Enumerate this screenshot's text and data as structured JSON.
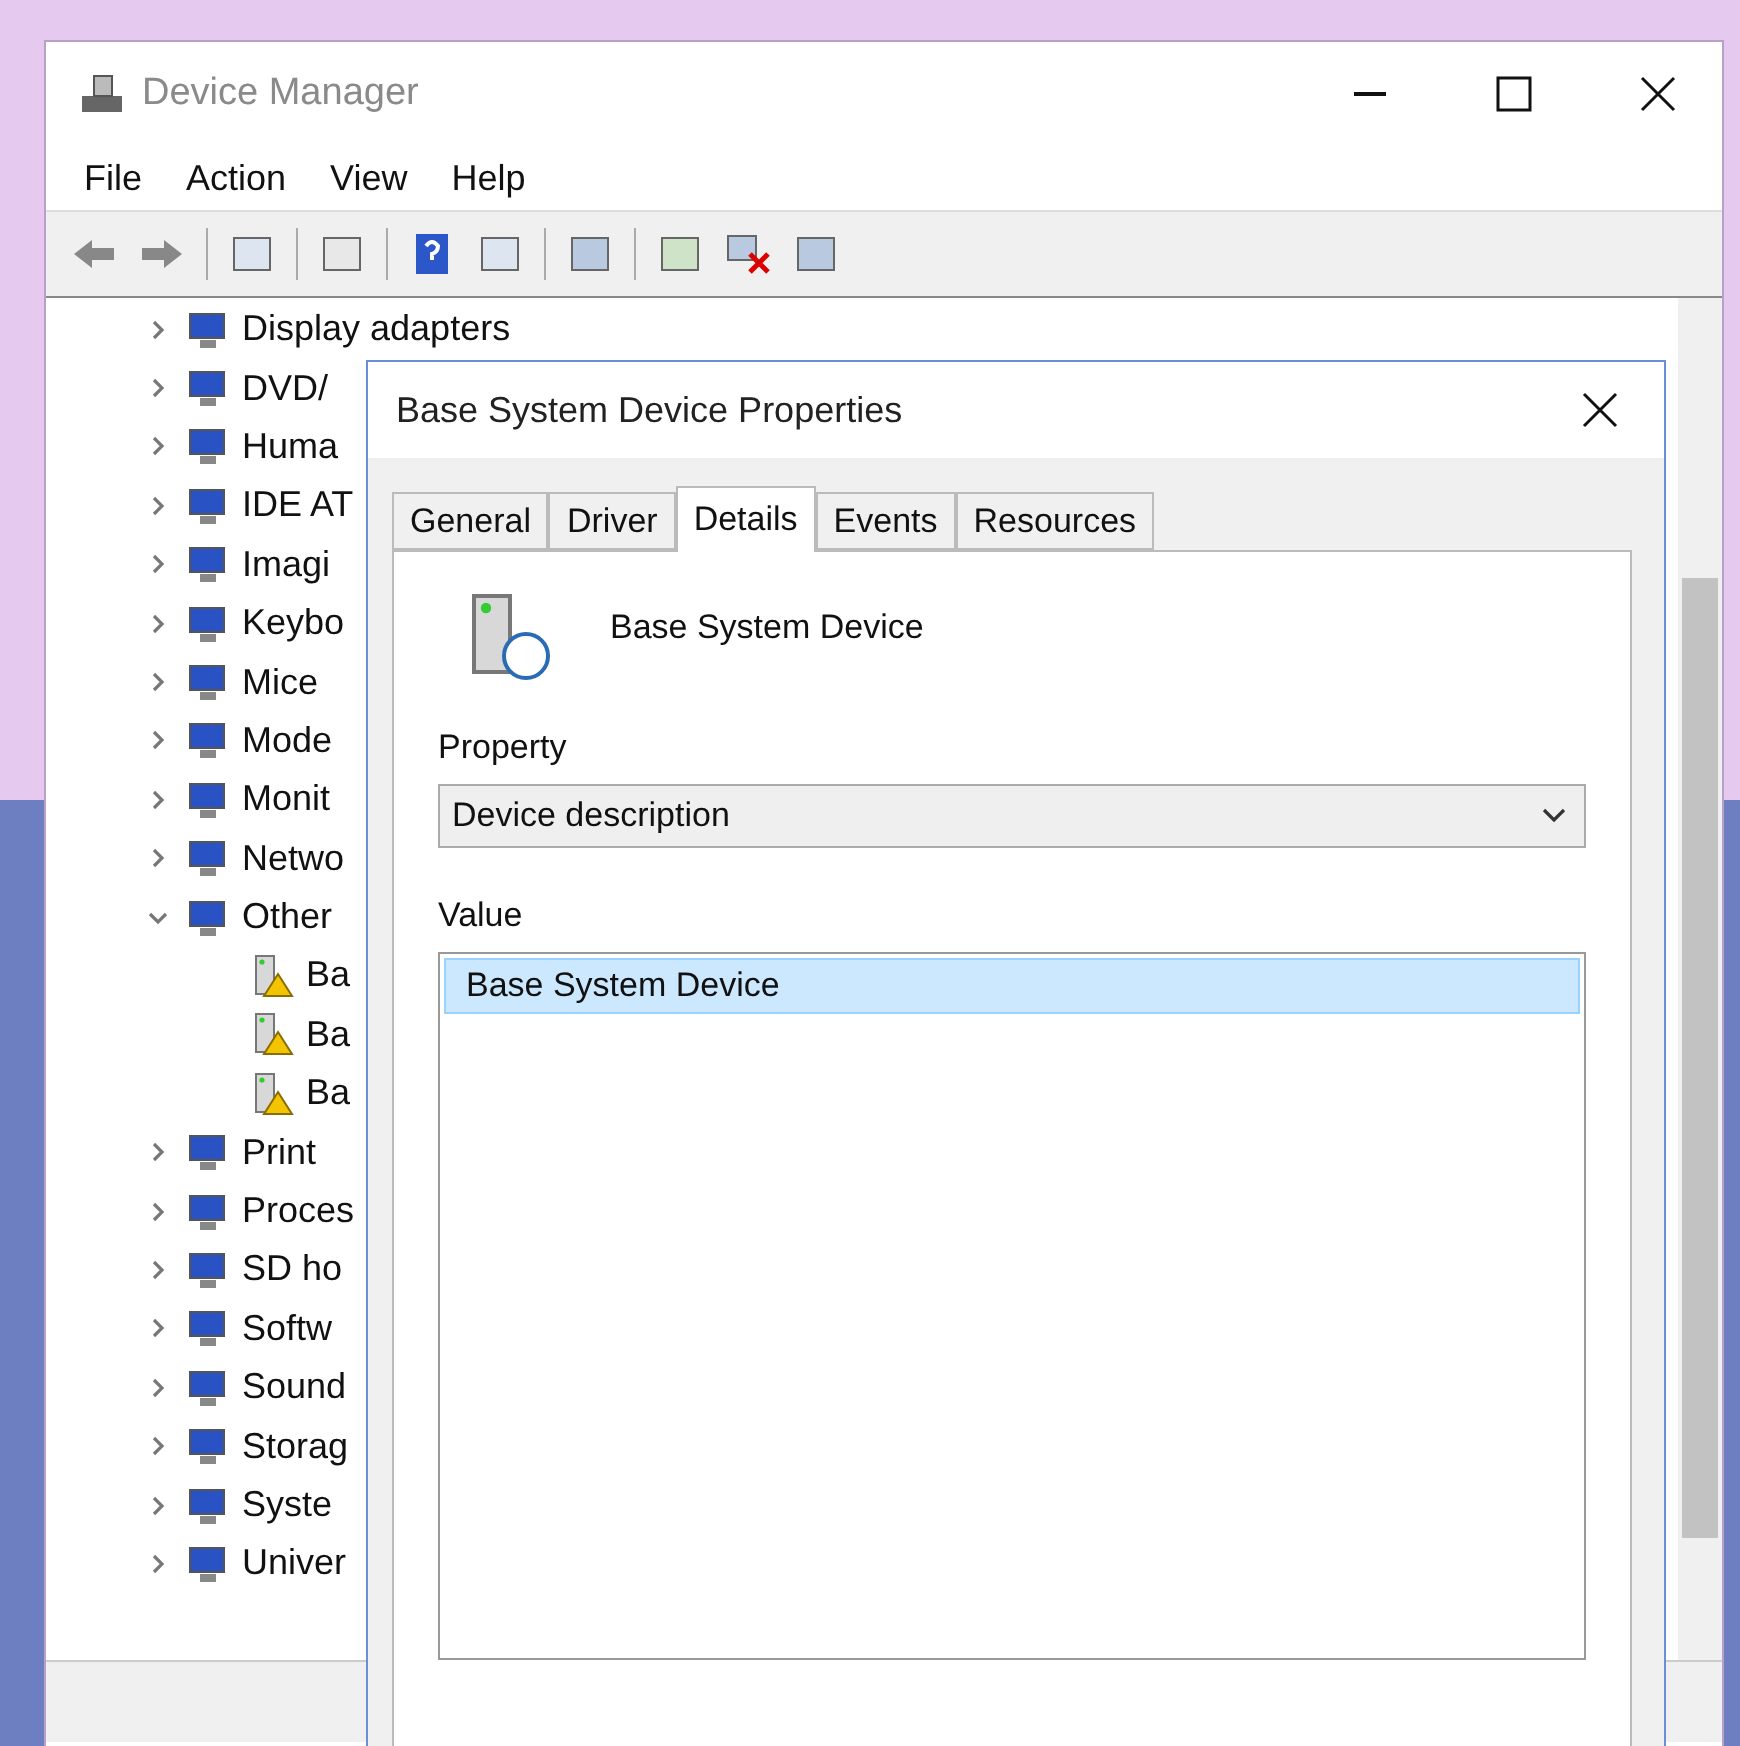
{
  "window": {
    "title": "Device Manager"
  },
  "menu": [
    "File",
    "Action",
    "View",
    "Help"
  ],
  "tree": [
    {
      "label": "Display adapters",
      "expanded": false
    },
    {
      "label": "DVD/",
      "expanded": false
    },
    {
      "label": "Huma",
      "expanded": false
    },
    {
      "label": "IDE AT",
      "expanded": false
    },
    {
      "label": "Imagi",
      "expanded": false
    },
    {
      "label": "Keybo",
      "expanded": false
    },
    {
      "label": "Mice",
      "expanded": false
    },
    {
      "label": "Mode",
      "expanded": false
    },
    {
      "label": "Monit",
      "expanded": false
    },
    {
      "label": "Netwo",
      "expanded": false
    },
    {
      "label": "Other",
      "expanded": true,
      "children": [
        {
          "label": "Ba"
        },
        {
          "label": "Ba"
        },
        {
          "label": "Ba"
        }
      ]
    },
    {
      "label": "Print",
      "expanded": false
    },
    {
      "label": "Proces",
      "expanded": false
    },
    {
      "label": "SD ho",
      "expanded": false
    },
    {
      "label": "Softw",
      "expanded": false
    },
    {
      "label": "Sound",
      "expanded": false
    },
    {
      "label": "Storag",
      "expanded": false
    },
    {
      "label": "Syste",
      "expanded": false
    },
    {
      "label": "Univer",
      "expanded": false
    }
  ],
  "dialog": {
    "title": "Base System Device Properties",
    "tabs": [
      {
        "label": "General",
        "selected": false
      },
      {
        "label": "Driver",
        "selected": false
      },
      {
        "label": "Details",
        "selected": true
      },
      {
        "label": "Events",
        "selected": false
      },
      {
        "label": "Resources",
        "selected": false
      }
    ],
    "device_name": "Base System Device",
    "property_label": "Property",
    "property_value": "Device description",
    "value_label": "Value",
    "values": [
      {
        "text": "Base System Device",
        "selected": true
      }
    ]
  }
}
